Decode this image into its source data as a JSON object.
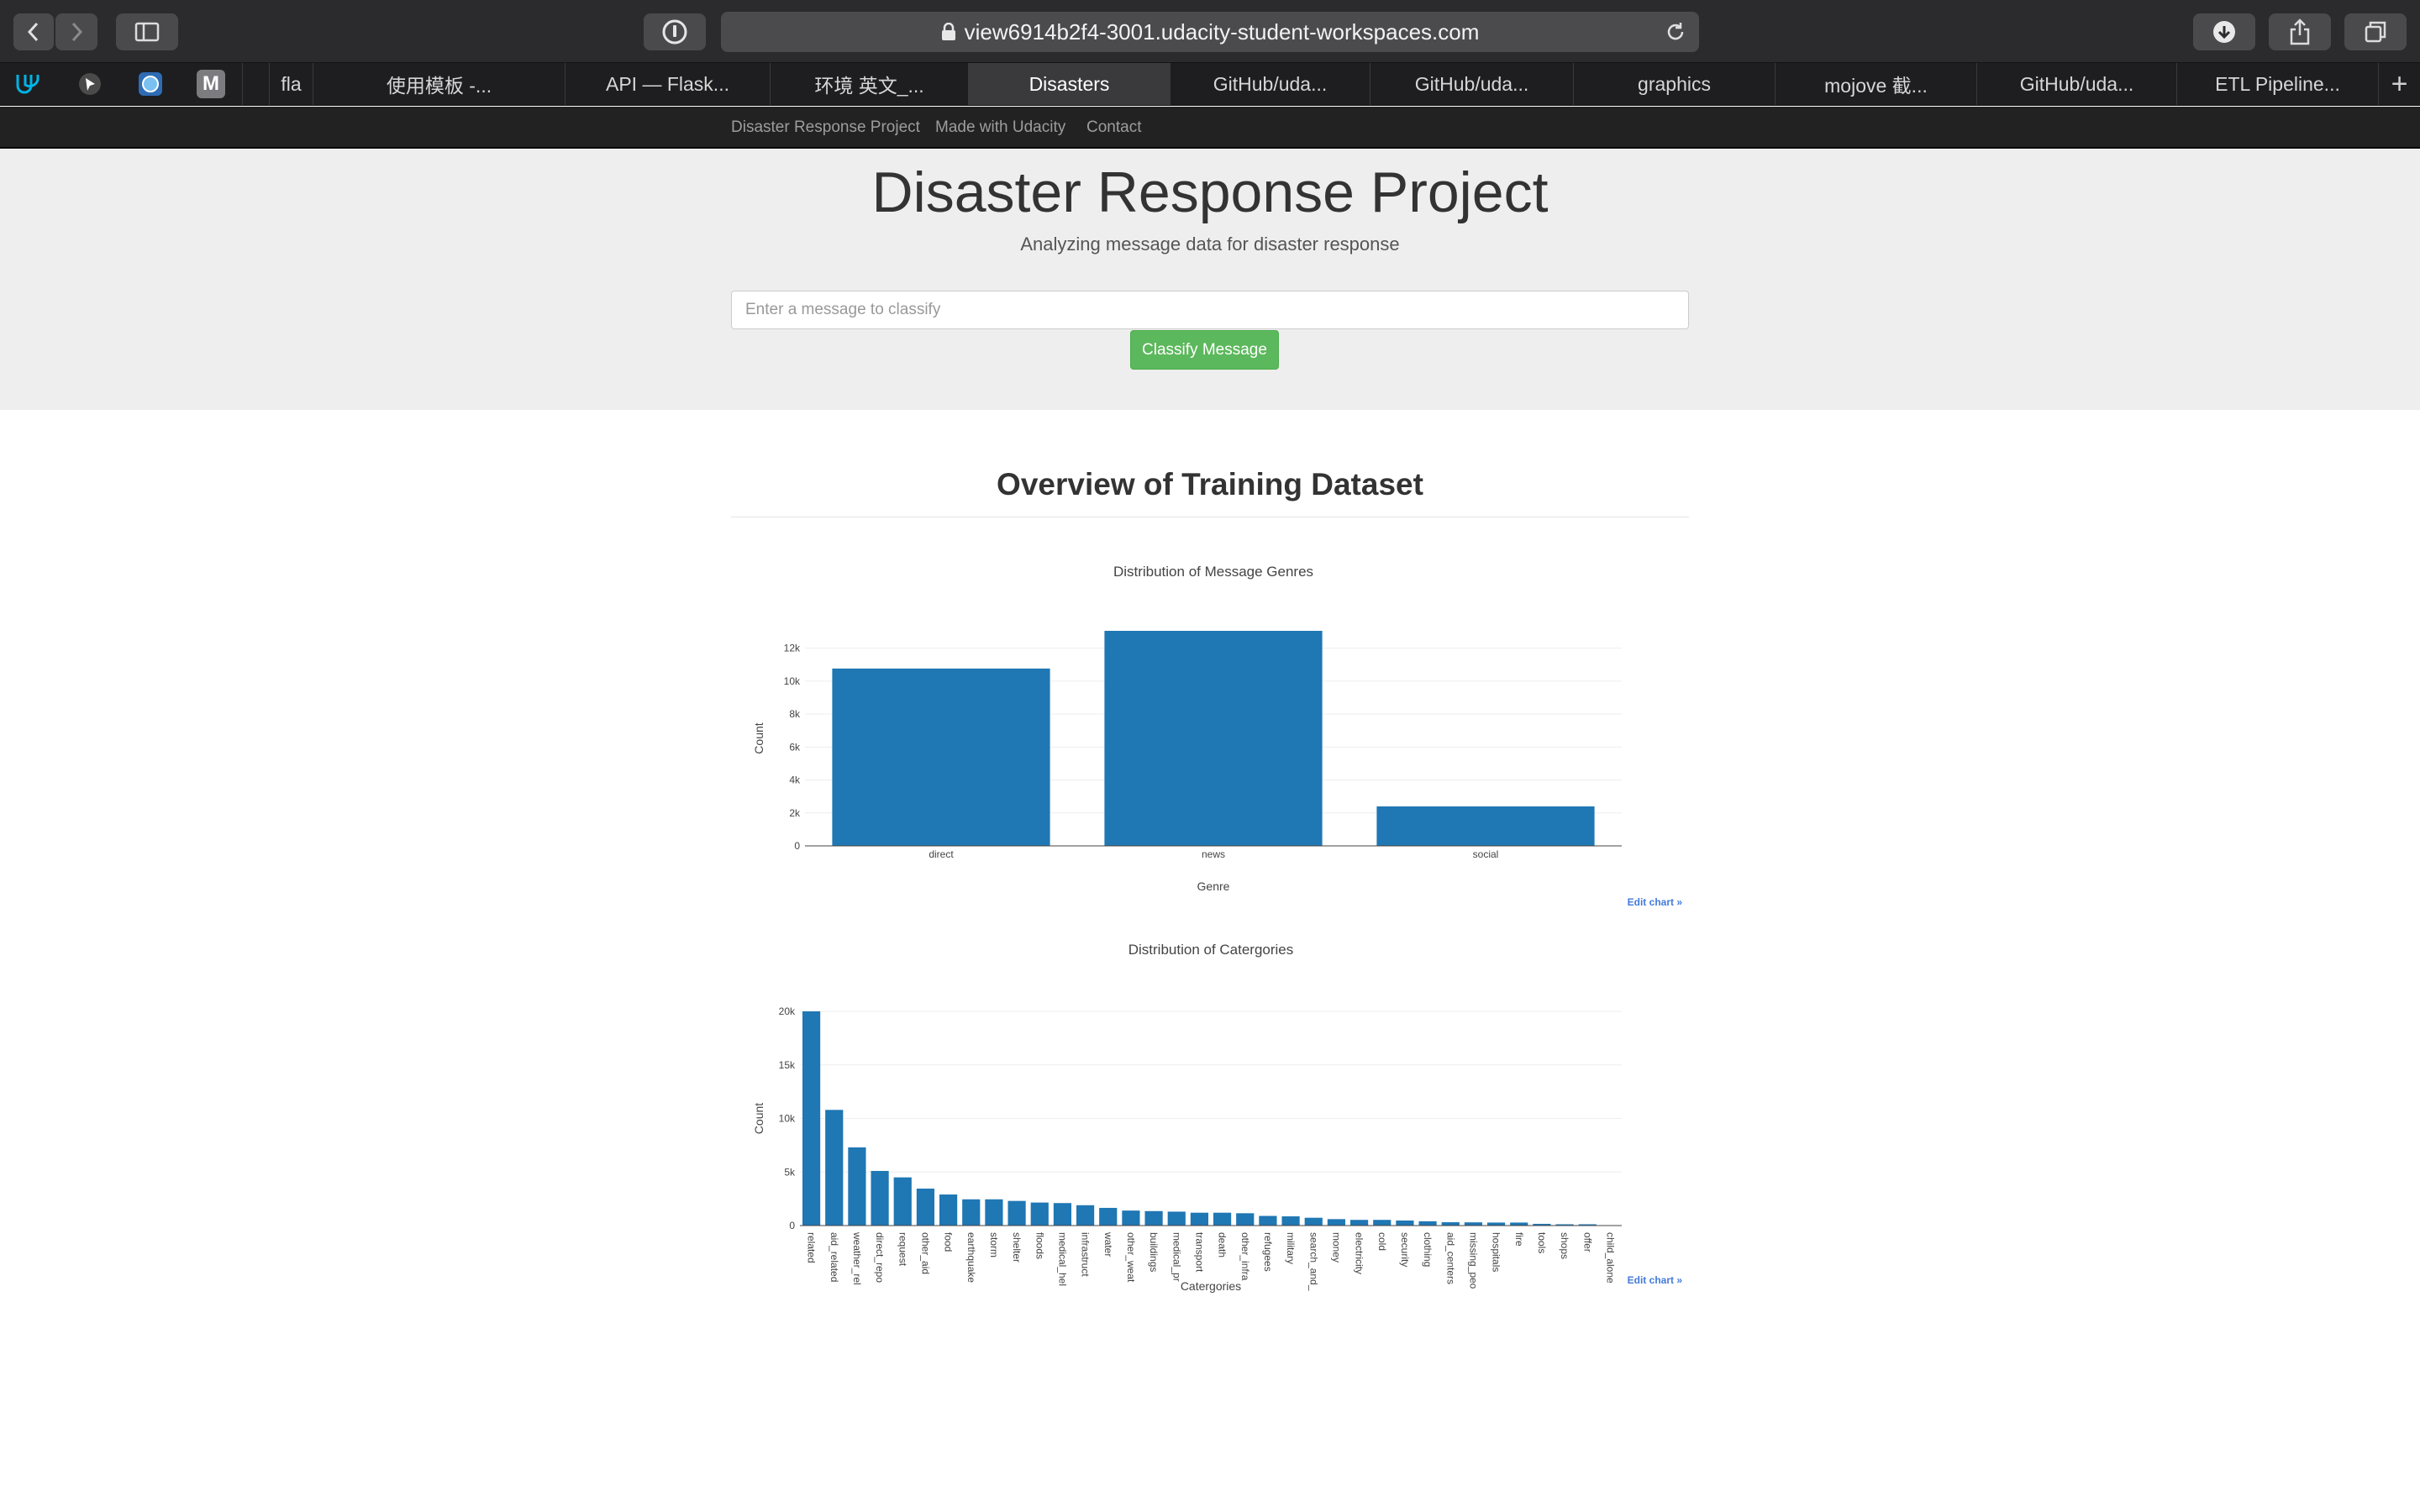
{
  "browser": {
    "url": "view6914b2f4-3001.udacity-student-workspaces.com",
    "tabs": [
      "fla",
      "使用模板 -...",
      "API — Flask...",
      "环境 英文_...",
      "Disasters",
      "GitHub/uda...",
      "GitHub/uda...",
      "graphics",
      "mojove 截...",
      "GitHub/uda...",
      "ETL Pipeline..."
    ],
    "active_tab": "Disasters",
    "new_tab_label": "+"
  },
  "navbar": {
    "brand": "Disaster Response Project",
    "links": [
      "Made with Udacity",
      "Contact"
    ]
  },
  "jumbotron": {
    "title": "Disaster Response Project",
    "subtitle": "Analyzing message data for disaster response",
    "input_placeholder": "Enter a message to classify",
    "button_label": "Classify Message"
  },
  "overview": {
    "title": "Overview of Training Dataset",
    "edit_label": "Edit chart »"
  },
  "colors": {
    "bar": "#1f77b4",
    "button": "#5cb85c",
    "link": "#447adb"
  },
  "chart_data": [
    {
      "type": "bar",
      "title": "Distribution of Message Genres",
      "xlabel": "Genre",
      "ylabel": "Count",
      "categories": [
        "direct",
        "news",
        "social"
      ],
      "values": [
        10766,
        13054,
        2396
      ],
      "ylim": [
        0,
        13054
      ],
      "yticks": [
        0,
        2000,
        4000,
        6000,
        8000,
        10000,
        12000
      ],
      "ytick_labels": [
        "0",
        "2k",
        "4k",
        "6k",
        "8k",
        "10k",
        "12k"
      ],
      "grid": true
    },
    {
      "type": "bar",
      "title": "Distribution of Catergories",
      "xlabel": "Catergories",
      "ylabel": "Count",
      "categories": [
        "related",
        "aid_related",
        "weather_rel",
        "direct_repo",
        "request",
        "other_aid",
        "food",
        "earthquake",
        "storm",
        "shelter",
        "floods",
        "medical_hel",
        "infrastructu",
        "water",
        "other_weat",
        "buildings",
        "medical_pr",
        "transport",
        "death",
        "other_infra",
        "refugees",
        "military",
        "search_and_",
        "money",
        "electricity",
        "cold",
        "security",
        "clothing",
        "aid_centers",
        "missing_peo",
        "hospitals",
        "fire",
        "tools",
        "shops",
        "offer",
        "child_alone"
      ],
      "values": [
        20000,
        10800,
        7300,
        5100,
        4500,
        3450,
        2900,
        2450,
        2450,
        2300,
        2150,
        2100,
        1900,
        1650,
        1400,
        1350,
        1300,
        1200,
        1200,
        1150,
        900,
        860,
        730,
        600,
        530,
        530,
        470,
        400,
        310,
        300,
        280,
        280,
        160,
        120,
        120,
        0
      ],
      "ylim": [
        0,
        20000
      ],
      "yticks": [
        0,
        5000,
        10000,
        15000,
        20000
      ],
      "ytick_labels": [
        "0",
        "5k",
        "10k",
        "15k",
        "20k"
      ],
      "grid": true
    }
  ]
}
